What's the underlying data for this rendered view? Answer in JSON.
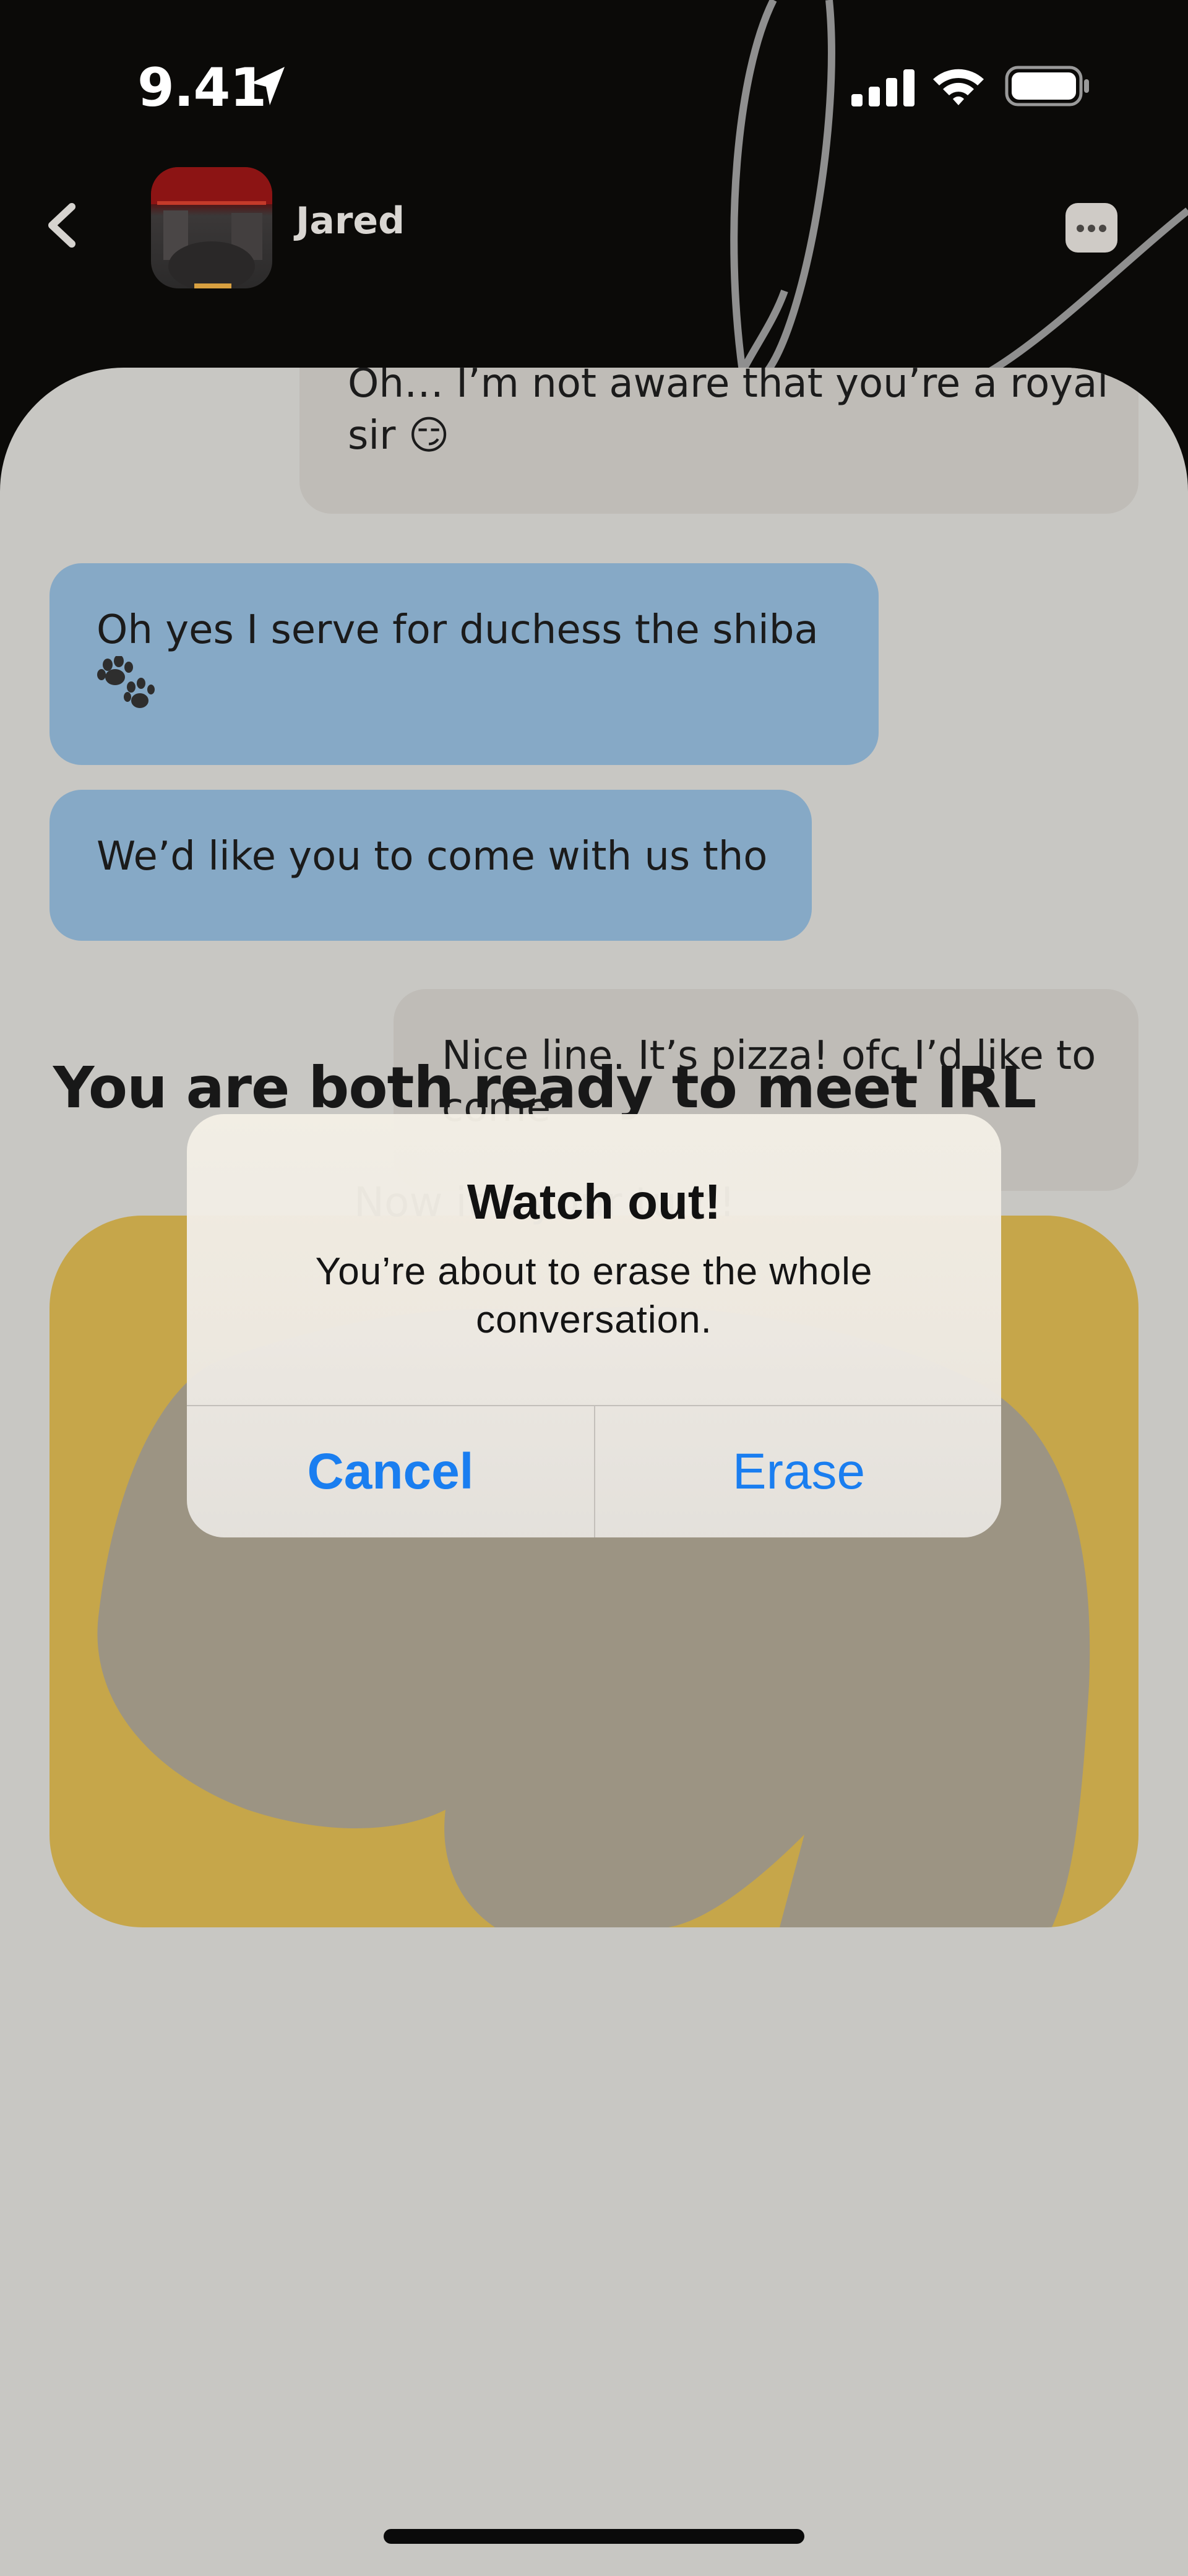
{
  "status_bar": {
    "time": "9.41",
    "icons": [
      "location-arrow-icon",
      "cellular-signal-icon",
      "wifi-icon",
      "battery-icon"
    ]
  },
  "nav": {
    "back_icon": "chevron-left-icon",
    "contact_name": "Jared",
    "more_icon": "ellipsis-icon"
  },
  "messages": [
    {
      "sender": "me",
      "text_line1": "Oh… I’m not aware that you’re a royal",
      "text_line2": "sir 😏"
    },
    {
      "sender": "them",
      "text_line1": "Oh yes I serve for duchess the shiba",
      "icon": "paw-prints-icon"
    },
    {
      "sender": "them",
      "text_line1": "We’d like you to come with us tho"
    },
    {
      "sender": "me",
      "text_line1": "Nice line. It’s pizza! ofc I’d like to",
      "text_line2": "come"
    }
  ],
  "ready_card": {
    "title": "You are both ready to meet IRL",
    "subtitle": "Now it’s your turn!"
  },
  "alert": {
    "title": "Watch out!",
    "message_line1": "You’re about to erase the whole",
    "message_line2": "conversation.",
    "cancel_label": "Cancel",
    "erase_label": "Erase"
  },
  "colors": {
    "header_bg": "#0b0a08",
    "sheet_bg": "#c8c7c3",
    "my_bubble": "#bfbcb7",
    "their_bubble": "#86a9c6",
    "card_yellow": "#c6a64a",
    "card_blob": "#9c9483",
    "ios_blue": "#1a7ef0"
  }
}
